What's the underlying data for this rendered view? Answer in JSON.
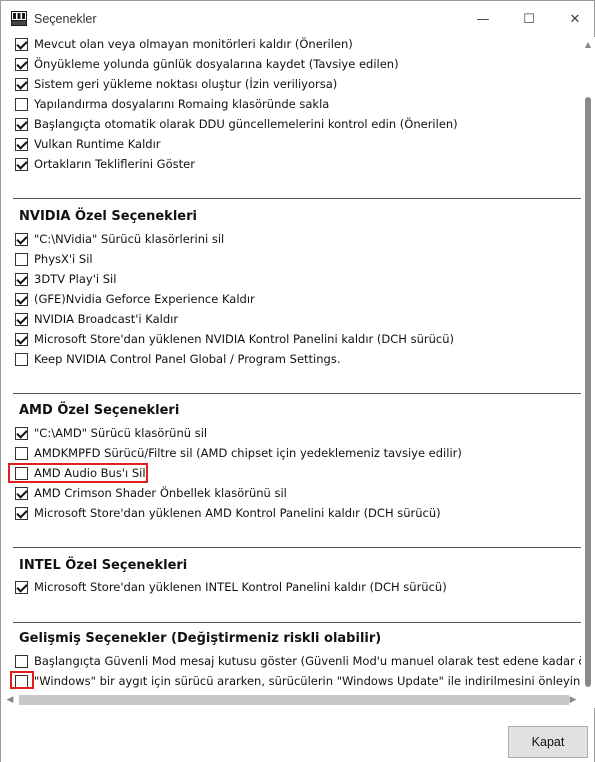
{
  "window": {
    "title": "Seçenekler",
    "icon_text": "DDU",
    "minimize_label": "—",
    "maximize_label": "☐",
    "close_label": "✕"
  },
  "general_options": [
    {
      "label": "Mevcut olan veya olmayan monitörleri kaldır (Önerilen)",
      "checked": true
    },
    {
      "label": "Önyükleme yolunda günlük dosyalarına kaydet (Tavsiye edilen)",
      "checked": true
    },
    {
      "label": "Sistem geri yükleme noktası oluştur (İzin veriliyorsa)",
      "checked": true
    },
    {
      "label": "Yapılandırma dosyalarını Romaing klasöründe sakla",
      "checked": false
    },
    {
      "label": "Başlangıçta otomatik olarak DDU güncellemelerini kontrol edin (Önerilen)",
      "checked": true
    },
    {
      "label": "Vulkan Runtime Kaldır",
      "checked": true
    },
    {
      "label": "Ortakların Tekliflerini Göster",
      "checked": true
    }
  ],
  "nvidia": {
    "title": "NVIDIA Özel Seçenekleri",
    "options": [
      {
        "label": "\"C:\\NVidia\" Sürücü klasörlerini sil",
        "checked": true
      },
      {
        "label": "PhysX'i Sil",
        "checked": false
      },
      {
        "label": "3DTV Play'i Sil",
        "checked": true
      },
      {
        "label": "(GFE)Nvidia Geforce Experience Kaldır",
        "checked": true
      },
      {
        "label": "NVIDIA Broadcast'i Kaldır",
        "checked": true
      },
      {
        "label": "Microsoft Store'dan yüklenen NVIDIA Kontrol Panelini kaldır (DCH sürücü)",
        "checked": true
      },
      {
        "label": "Keep NVIDIA Control Panel Global / Program Settings.",
        "checked": false
      }
    ]
  },
  "amd": {
    "title": "AMD Özel Seçenekleri",
    "options": [
      {
        "label": "\"C:\\AMD\" Sürücü klasörünü sil",
        "checked": true
      },
      {
        "label": "AMDKMPFD Sürücü/Filtre sil (AMD chipset için yedeklemeniz tavsiye edilir)",
        "checked": false
      },
      {
        "label": "AMD Audio Bus'ı Sil",
        "checked": false
      },
      {
        "label": "AMD Crimson Shader Önbellek klasörünü sil",
        "checked": true
      },
      {
        "label": "Microsoft Store'dan yüklenen AMD Kontrol Panelini kaldır (DCH sürücü)",
        "checked": true
      }
    ]
  },
  "intel": {
    "title": "INTEL Özel Seçenekleri",
    "options": [
      {
        "label": "Microsoft Store'dan yüklenen INTEL Kontrol Panelini kaldır (DCH sürücü)",
        "checked": true
      }
    ]
  },
  "advanced": {
    "title": "Gelişmiş Seçenekler (Değiştirmeniz riskli olabilir)",
    "options": [
      {
        "label": "Başlangıçta Güvenli Mod mesaj kutusu göster (Güvenli Mod'u manuel olarak test edene kadar önerilmez)",
        "checked": false
      },
      {
        "label": "\"Windows\" bir aygıt için sürücü ararken, sürücülerin \"Windows Update\" ile indirilmesini önleyin.",
        "checked": false
      }
    ]
  },
  "scrollbars": {
    "up_arrow": "▲",
    "down_arrow": "▼",
    "left_arrow": "◀",
    "right_arrow": "▶"
  },
  "footer": {
    "close_button_label": "Kapat"
  },
  "colors": {
    "highlight": "#e02020"
  }
}
